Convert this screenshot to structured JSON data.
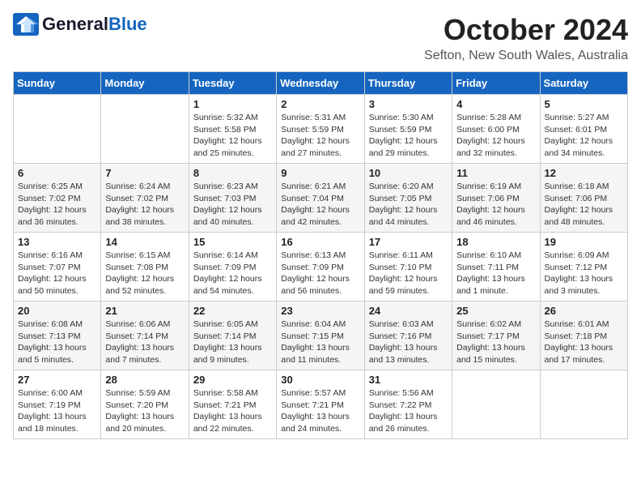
{
  "logo": {
    "general": "General",
    "blue": "Blue"
  },
  "title": "October 2024",
  "location": "Sefton, New South Wales, Australia",
  "days_of_week": [
    "Sunday",
    "Monday",
    "Tuesday",
    "Wednesday",
    "Thursday",
    "Friday",
    "Saturday"
  ],
  "weeks": [
    [
      {
        "day": "",
        "info": ""
      },
      {
        "day": "",
        "info": ""
      },
      {
        "day": "1",
        "info": "Sunrise: 5:32 AM\nSunset: 5:58 PM\nDaylight: 12 hours\nand 25 minutes."
      },
      {
        "day": "2",
        "info": "Sunrise: 5:31 AM\nSunset: 5:59 PM\nDaylight: 12 hours\nand 27 minutes."
      },
      {
        "day": "3",
        "info": "Sunrise: 5:30 AM\nSunset: 5:59 PM\nDaylight: 12 hours\nand 29 minutes."
      },
      {
        "day": "4",
        "info": "Sunrise: 5:28 AM\nSunset: 6:00 PM\nDaylight: 12 hours\nand 32 minutes."
      },
      {
        "day": "5",
        "info": "Sunrise: 5:27 AM\nSunset: 6:01 PM\nDaylight: 12 hours\nand 34 minutes."
      }
    ],
    [
      {
        "day": "6",
        "info": "Sunrise: 6:25 AM\nSunset: 7:02 PM\nDaylight: 12 hours\nand 36 minutes."
      },
      {
        "day": "7",
        "info": "Sunrise: 6:24 AM\nSunset: 7:02 PM\nDaylight: 12 hours\nand 38 minutes."
      },
      {
        "day": "8",
        "info": "Sunrise: 6:23 AM\nSunset: 7:03 PM\nDaylight: 12 hours\nand 40 minutes."
      },
      {
        "day": "9",
        "info": "Sunrise: 6:21 AM\nSunset: 7:04 PM\nDaylight: 12 hours\nand 42 minutes."
      },
      {
        "day": "10",
        "info": "Sunrise: 6:20 AM\nSunset: 7:05 PM\nDaylight: 12 hours\nand 44 minutes."
      },
      {
        "day": "11",
        "info": "Sunrise: 6:19 AM\nSunset: 7:06 PM\nDaylight: 12 hours\nand 46 minutes."
      },
      {
        "day": "12",
        "info": "Sunrise: 6:18 AM\nSunset: 7:06 PM\nDaylight: 12 hours\nand 48 minutes."
      }
    ],
    [
      {
        "day": "13",
        "info": "Sunrise: 6:16 AM\nSunset: 7:07 PM\nDaylight: 12 hours\nand 50 minutes."
      },
      {
        "day": "14",
        "info": "Sunrise: 6:15 AM\nSunset: 7:08 PM\nDaylight: 12 hours\nand 52 minutes."
      },
      {
        "day": "15",
        "info": "Sunrise: 6:14 AM\nSunset: 7:09 PM\nDaylight: 12 hours\nand 54 minutes."
      },
      {
        "day": "16",
        "info": "Sunrise: 6:13 AM\nSunset: 7:09 PM\nDaylight: 12 hours\nand 56 minutes."
      },
      {
        "day": "17",
        "info": "Sunrise: 6:11 AM\nSunset: 7:10 PM\nDaylight: 12 hours\nand 59 minutes."
      },
      {
        "day": "18",
        "info": "Sunrise: 6:10 AM\nSunset: 7:11 PM\nDaylight: 13 hours\nand 1 minute."
      },
      {
        "day": "19",
        "info": "Sunrise: 6:09 AM\nSunset: 7:12 PM\nDaylight: 13 hours\nand 3 minutes."
      }
    ],
    [
      {
        "day": "20",
        "info": "Sunrise: 6:08 AM\nSunset: 7:13 PM\nDaylight: 13 hours\nand 5 minutes."
      },
      {
        "day": "21",
        "info": "Sunrise: 6:06 AM\nSunset: 7:14 PM\nDaylight: 13 hours\nand 7 minutes."
      },
      {
        "day": "22",
        "info": "Sunrise: 6:05 AM\nSunset: 7:14 PM\nDaylight: 13 hours\nand 9 minutes."
      },
      {
        "day": "23",
        "info": "Sunrise: 6:04 AM\nSunset: 7:15 PM\nDaylight: 13 hours\nand 11 minutes."
      },
      {
        "day": "24",
        "info": "Sunrise: 6:03 AM\nSunset: 7:16 PM\nDaylight: 13 hours\nand 13 minutes."
      },
      {
        "day": "25",
        "info": "Sunrise: 6:02 AM\nSunset: 7:17 PM\nDaylight: 13 hours\nand 15 minutes."
      },
      {
        "day": "26",
        "info": "Sunrise: 6:01 AM\nSunset: 7:18 PM\nDaylight: 13 hours\nand 17 minutes."
      }
    ],
    [
      {
        "day": "27",
        "info": "Sunrise: 6:00 AM\nSunset: 7:19 PM\nDaylight: 13 hours\nand 18 minutes."
      },
      {
        "day": "28",
        "info": "Sunrise: 5:59 AM\nSunset: 7:20 PM\nDaylight: 13 hours\nand 20 minutes."
      },
      {
        "day": "29",
        "info": "Sunrise: 5:58 AM\nSunset: 7:21 PM\nDaylight: 13 hours\nand 22 minutes."
      },
      {
        "day": "30",
        "info": "Sunrise: 5:57 AM\nSunset: 7:21 PM\nDaylight: 13 hours\nand 24 minutes."
      },
      {
        "day": "31",
        "info": "Sunrise: 5:56 AM\nSunset: 7:22 PM\nDaylight: 13 hours\nand 26 minutes."
      },
      {
        "day": "",
        "info": ""
      },
      {
        "day": "",
        "info": ""
      }
    ]
  ]
}
